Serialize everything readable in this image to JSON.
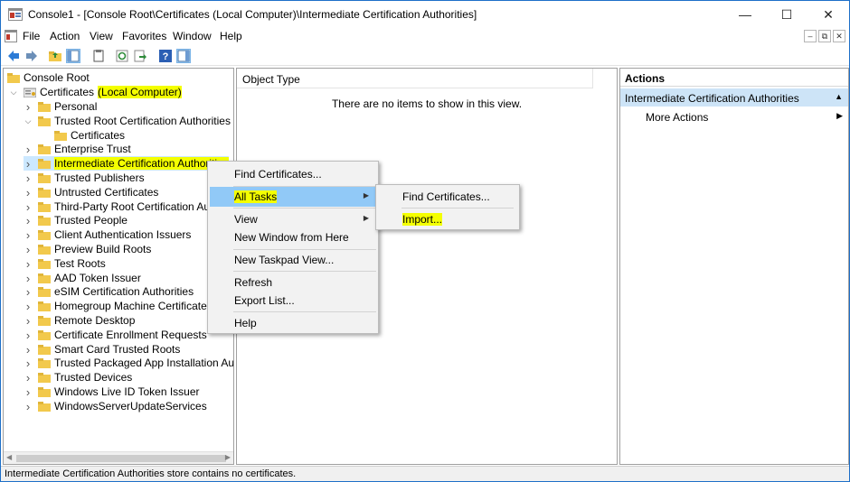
{
  "window": {
    "title": "Console1 - [Console Root\\Certificates (Local Computer)\\Intermediate Certification Authorities]",
    "minimize": "—",
    "maximize": "☐",
    "close": "✕"
  },
  "menu": {
    "items": [
      "File",
      "Action",
      "View",
      "Favorites",
      "Window",
      "Help"
    ],
    "mdi": [
      "–",
      "⧉",
      "✕"
    ]
  },
  "toolbar": {
    "buttons": [
      "back-icon",
      "forward-icon",
      "up-folder-icon",
      "show-hide-tree-icon",
      "properties-icon",
      "refresh-icon",
      "export-icon",
      "help-icon",
      "show-hide-action-pane-icon"
    ]
  },
  "tree": {
    "root": "Console Root",
    "certificates_prefix": "Certificates",
    "certificates_suffix": "(Local Computer)",
    "items": [
      {
        "label": "Personal",
        "expanded": false
      },
      {
        "label": "Trusted Root Certification Authorities",
        "expanded": true
      },
      {
        "label": "Certificates",
        "expanded": null
      },
      {
        "label": "Enterprise Trust",
        "expanded": false
      },
      {
        "label": "Intermediate Certification Authorities",
        "expanded": false
      },
      {
        "label": "Trusted Publishers",
        "expanded": false
      },
      {
        "label": "Untrusted Certificates",
        "expanded": false
      },
      {
        "label": "Third-Party Root Certification Authorities",
        "expanded": false
      },
      {
        "label": "Trusted People",
        "expanded": false
      },
      {
        "label": "Client Authentication Issuers",
        "expanded": false
      },
      {
        "label": "Preview Build Roots",
        "expanded": false
      },
      {
        "label": "Test Roots",
        "expanded": false
      },
      {
        "label": "AAD Token Issuer",
        "expanded": false
      },
      {
        "label": "eSIM Certification Authorities",
        "expanded": false
      },
      {
        "label": "Homegroup Machine Certificates",
        "expanded": false
      },
      {
        "label": "Remote Desktop",
        "expanded": false
      },
      {
        "label": "Certificate Enrollment Requests",
        "expanded": false
      },
      {
        "label": "Smart Card Trusted Roots",
        "expanded": false
      },
      {
        "label": "Trusted Packaged App Installation Authorities",
        "expanded": false
      },
      {
        "label": "Trusted Devices",
        "expanded": false
      },
      {
        "label": "Windows Live ID Token Issuer",
        "expanded": false
      },
      {
        "label": "WindowsServerUpdateServices",
        "expanded": false
      }
    ]
  },
  "list": {
    "column": "Object Type",
    "empty_message": "There are no items to show in this view."
  },
  "actions": {
    "header": "Actions",
    "section": "Intermediate Certification Authorities",
    "more": "More Actions"
  },
  "context_menu": {
    "items": [
      "Find Certificates...",
      "All Tasks",
      "View",
      "New Window from Here",
      "New Taskpad View...",
      "Refresh",
      "Export List...",
      "Help"
    ]
  },
  "submenu": {
    "items": [
      "Find Certificates...",
      "Import..."
    ]
  },
  "status": {
    "text": "Intermediate Certification Authorities store contains no certificates."
  },
  "colors": {
    "highlight": "#f4ff00",
    "selection": "#cce8ff",
    "menu_hover": "#91c9f7",
    "folder": "#f2c94c",
    "accent": "#1e6fc8"
  }
}
